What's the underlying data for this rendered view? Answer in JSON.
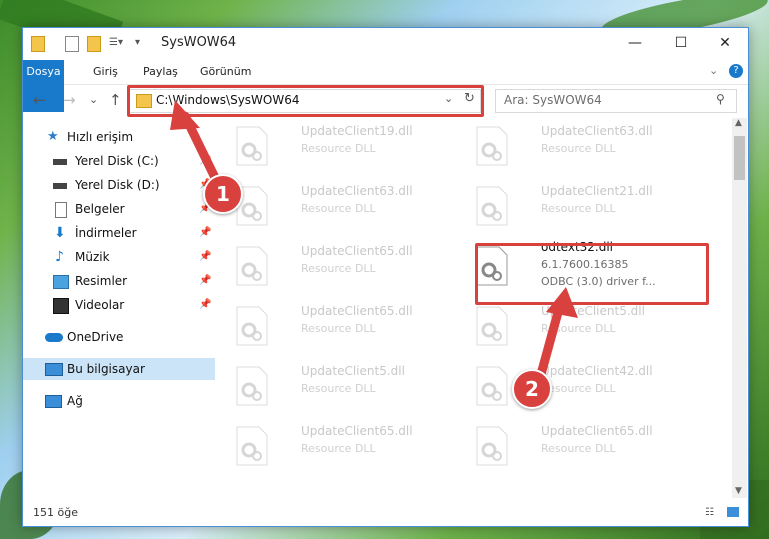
{
  "window": {
    "title": "SysWOW64",
    "minimize": "—",
    "maximize": "☐",
    "close": "✕"
  },
  "ribbon": {
    "tabs": [
      "Dosya",
      "Giriş",
      "Paylaş",
      "Görünüm"
    ]
  },
  "nav": {
    "back": "←",
    "forward": "→",
    "recent": "⌄",
    "up": "↑",
    "address": "C:\\Windows\\SysWOW64",
    "refresh": "↻",
    "search_placeholder": "Ara: SysWOW64"
  },
  "sidebar": {
    "items": [
      {
        "label": "Hızlı erişim",
        "icon": "star-icon"
      },
      {
        "label": "Yerel Disk (C:)",
        "icon": "drive-icon"
      },
      {
        "label": "Yerel Disk (D:)",
        "icon": "drive-icon"
      },
      {
        "label": "Belgeler",
        "icon": "documents-icon"
      },
      {
        "label": "İndirmeler",
        "icon": "download-icon"
      },
      {
        "label": "Müzik",
        "icon": "music-icon"
      },
      {
        "label": "Resimler",
        "icon": "pictures-icon"
      },
      {
        "label": "Videolar",
        "icon": "videos-icon"
      },
      {
        "label": "OneDrive",
        "icon": "cloud-icon"
      },
      {
        "label": "Bu bilgisayar",
        "icon": "computer-icon"
      },
      {
        "label": "Ağ",
        "icon": "network-icon"
      }
    ]
  },
  "files": [
    {
      "name": "UpdateClient19.dll",
      "desc": "Resource DLL"
    },
    {
      "name": "UpdateClient63.dll",
      "desc": "Resource DLL"
    },
    {
      "name": "UpdateClient63.dll",
      "desc": "Resource DLL"
    },
    {
      "name": "UpdateClient21.dll",
      "desc": "Resource DLL"
    },
    {
      "name": "UpdateClient65.dll",
      "desc": "Resource DLL"
    },
    {
      "name": "odtext32.dll",
      "desc": "6.1.7600.16385",
      "desc2": "ODBC (3.0) driver f..."
    },
    {
      "name": "UpdateClient65.dll",
      "desc": "Resource DLL"
    },
    {
      "name": "UpdateClient5.dll",
      "desc": "Resource DLL"
    },
    {
      "name": "UpdateClient5.dll",
      "desc": "Resource DLL"
    },
    {
      "name": "UpdateClient42.dll",
      "desc": "Resource DLL"
    },
    {
      "name": "UpdateClient65.dll",
      "desc": "Resource DLL"
    },
    {
      "name": "UpdateClient65.dll",
      "desc": "Resource DLL"
    }
  ],
  "status": {
    "count": "151 öğe"
  },
  "annotations": {
    "step1": "1",
    "step2": "2",
    "accent": "#d9413f"
  }
}
